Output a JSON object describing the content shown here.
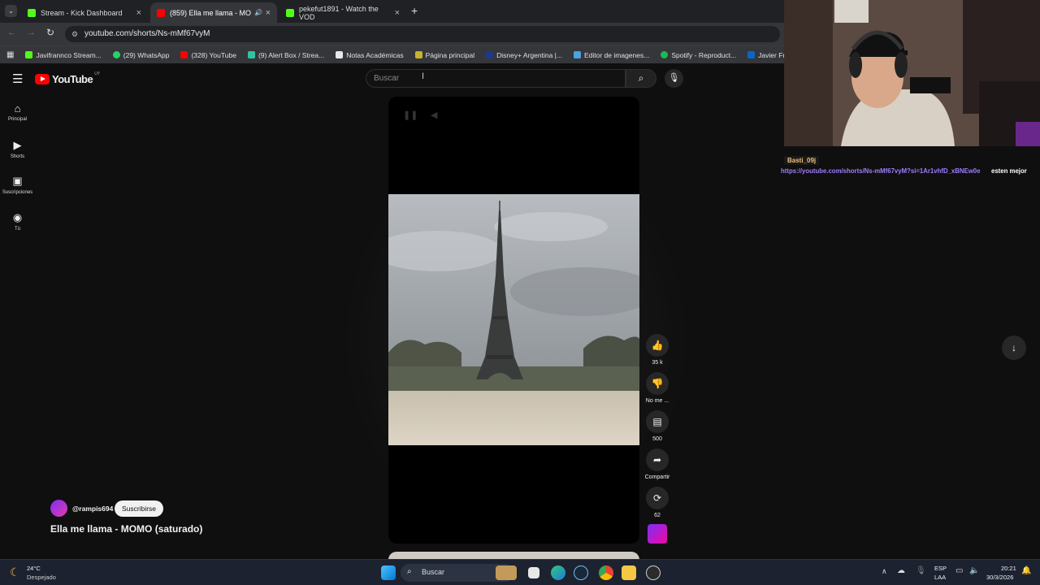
{
  "browser": {
    "tabs": [
      {
        "label": "Stream - Kick Dashboard",
        "active": false
      },
      {
        "label": "(859) Ella me llama - MOM",
        "active": true
      },
      {
        "label": "pekefut1891 - Watch the VOD",
        "active": false
      }
    ],
    "url": "youtube.com/shorts/Ns-mMf67vyM",
    "bookmarks": [
      "Javifrannco Stream...",
      "(29) WhatsApp",
      "(328) YouTube",
      "(9) Alert Box / Strea...",
      "Notas Académicas",
      "Página principal",
      "Disney+ Argentina |...",
      "Editor de imagenes...",
      "Spotify - Reproduct...",
      "Javier Franco | Link"
    ]
  },
  "youtube": {
    "logo": "YouTube",
    "region": "UY",
    "search_placeholder": "Buscar",
    "sidebar": [
      {
        "label": "Principal",
        "icon": "home-icon"
      },
      {
        "label": "Shorts",
        "icon": "shorts-icon"
      },
      {
        "label": "Suscripciones",
        "icon": "subscriptions-icon"
      },
      {
        "label": "Tú",
        "icon": "account-icon"
      }
    ],
    "actions": {
      "likes": "35 k",
      "dislike": "No me ...",
      "comments": "500",
      "share": "Compartir",
      "remix": "62"
    },
    "channel": "@rampis694",
    "subscribe": "Suscribirse",
    "video_title": "Ella me llama - MOMO (saturado)"
  },
  "overlay": {
    "chat_user": "Basti_09j",
    "chat_link": "https://youtube.com/shorts/Ns-mMf67vyM?si=1Ar1vhfD_xBNEw0e",
    "chat_text": "esten mejor"
  },
  "taskbar": {
    "temperature": "24°C",
    "weather": "Despejado",
    "search": "Buscar",
    "lang1": "ESP",
    "lang2": "LAA",
    "time": "20:21",
    "date": "30/3/2026"
  }
}
